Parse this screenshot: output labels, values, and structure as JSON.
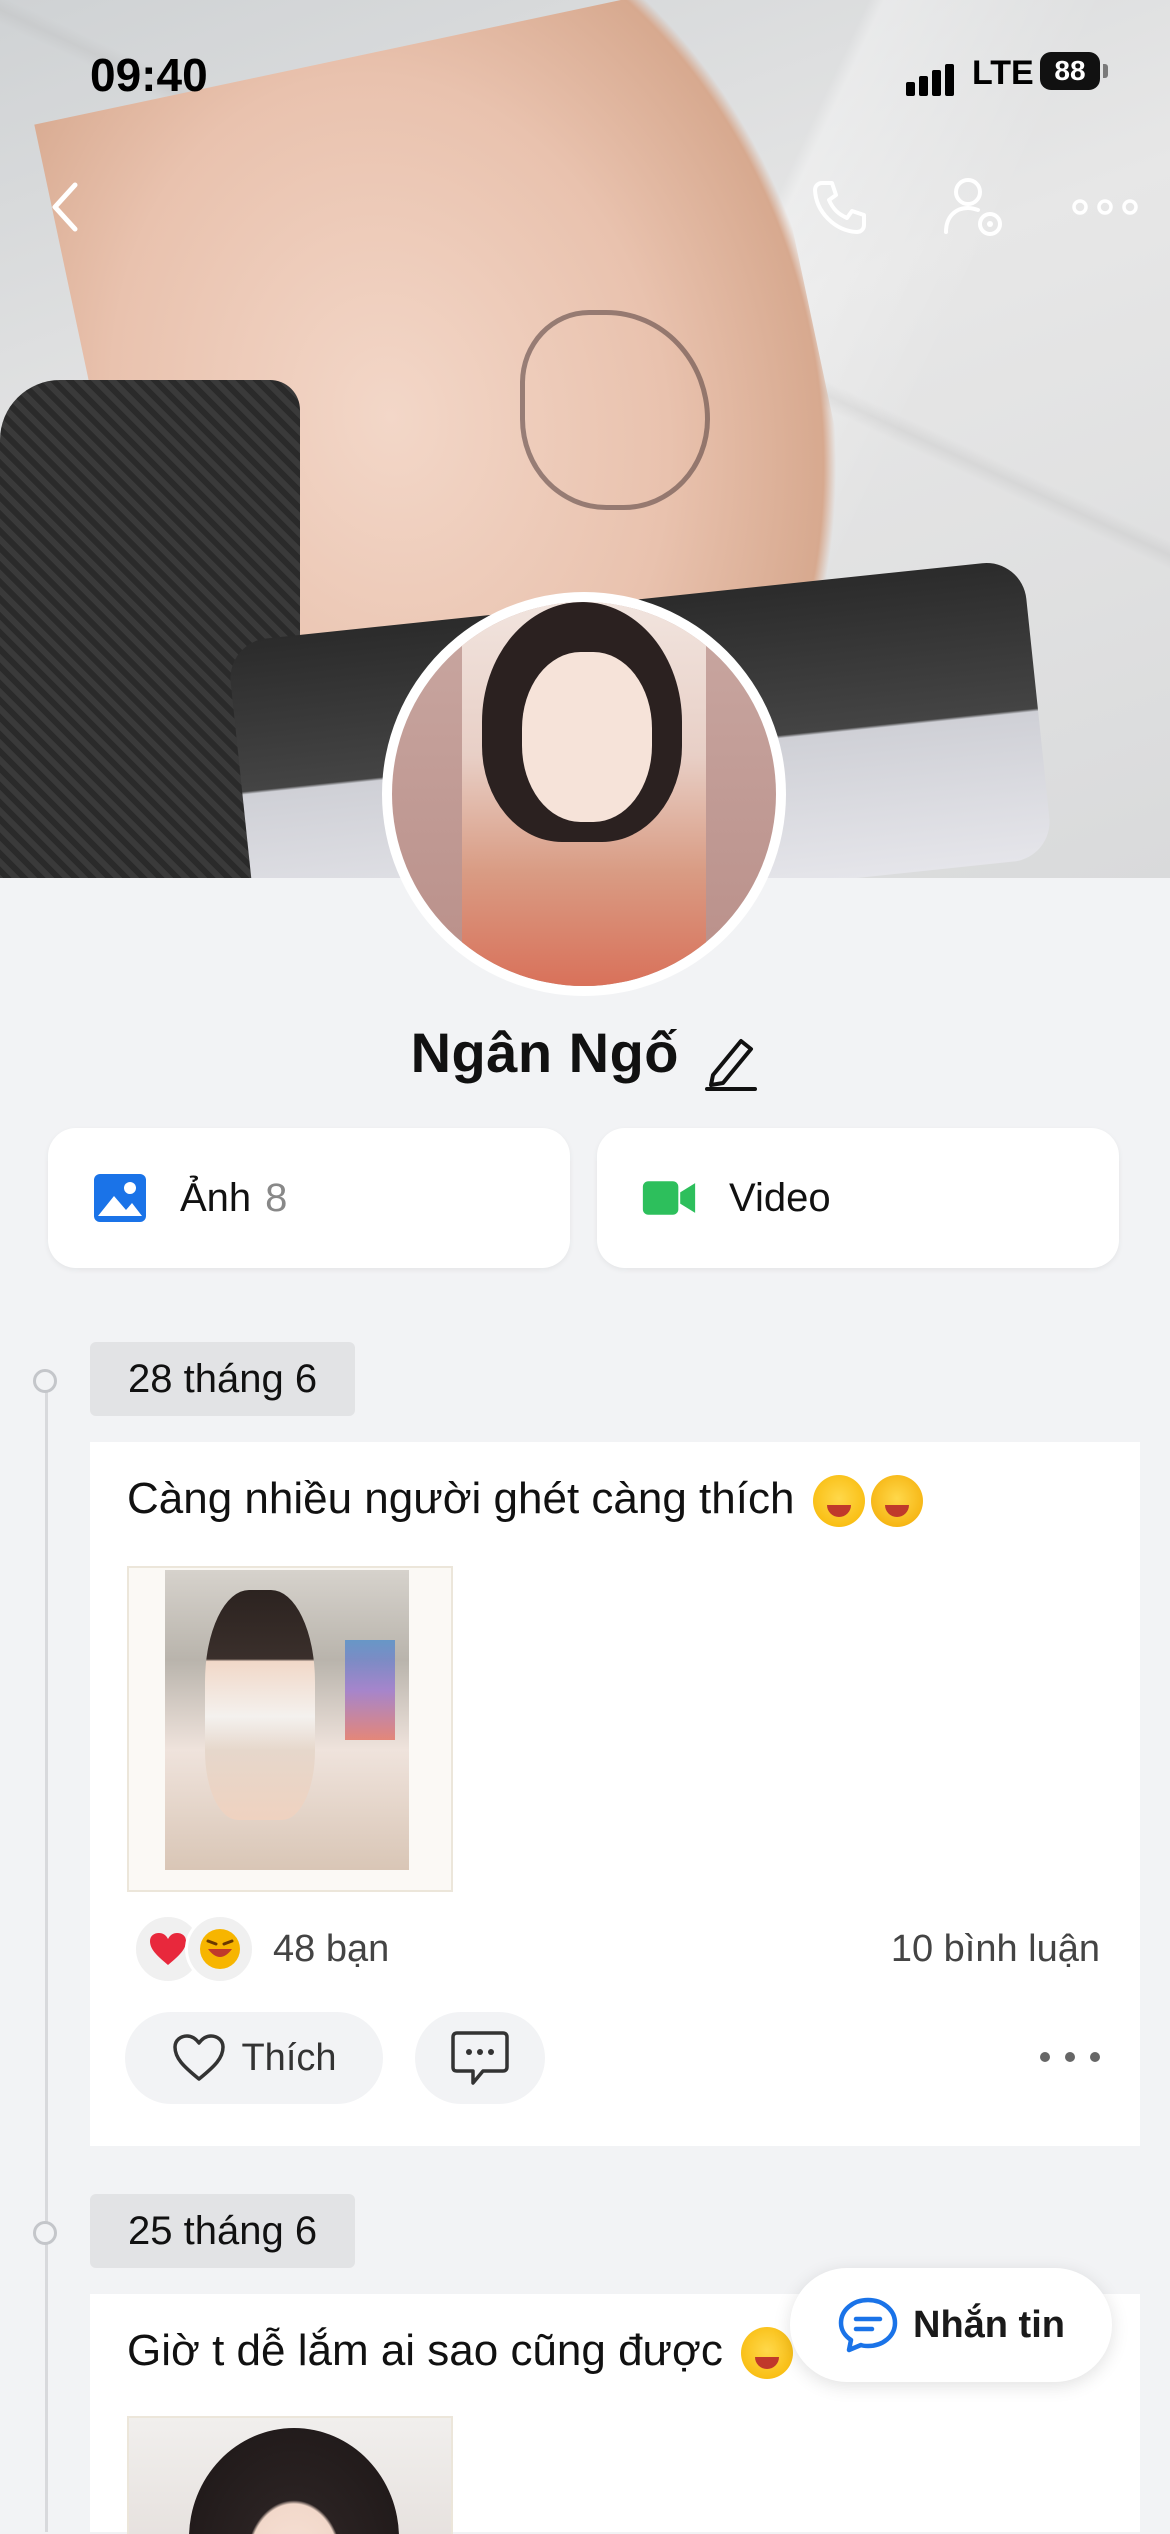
{
  "status_bar": {
    "time": "09:40",
    "network": "LTE",
    "battery": "88"
  },
  "profile": {
    "name": "Ngân Ngố"
  },
  "media": {
    "photos_label": "Ảnh",
    "photos_count": "8",
    "video_label": "Video"
  },
  "posts": [
    {
      "date": "28 tháng 6",
      "text": "Càng nhiều người ghét càng thích",
      "reactions_count": "48 bạn",
      "comments_count": "10 bình luận",
      "like_label": "Thích"
    },
    {
      "date": "25 tháng 6",
      "text": "Giờ t dễ lắm ai sao cũng được"
    }
  ],
  "message_button": {
    "label": "Nhắn tin"
  },
  "icons": {
    "back": "chevron-left-icon",
    "call": "phone-icon",
    "settings": "user-settings-icon",
    "more": "more-horizontal-icon",
    "edit": "pencil-icon",
    "photos": "image-icon",
    "video": "video-camera-icon",
    "heart": "heart-icon",
    "comment": "comment-icon",
    "message": "chat-bubble-icon"
  },
  "colors": {
    "accent_blue": "#1a73e8",
    "video_green": "#2dbf5c",
    "heart_red": "#e8283c",
    "background": "#f2f3f5"
  }
}
